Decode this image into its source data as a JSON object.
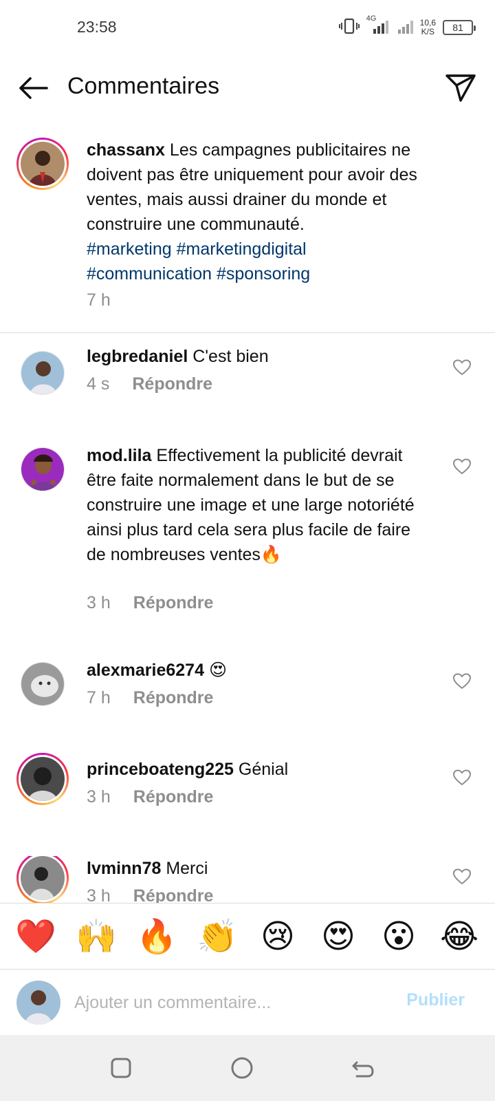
{
  "status": {
    "time": "23:58",
    "network": "4G",
    "speed_value": "10,6",
    "speed_unit": "K/S",
    "battery": "81"
  },
  "header": {
    "title": "Commentaires",
    "back_icon": "arrow-left-icon",
    "share_icon": "paper-plane-icon"
  },
  "caption": {
    "username": "chassanx",
    "text": "Les campagnes publicitaires ne doivent pas être uniquement pour avoir des ventes, mais aussi drainer du monde et construire une communauté.",
    "hashtags": [
      "#marketing",
      "#marketingdigital",
      "#communication",
      "#sponsoring"
    ],
    "time": "7 h"
  },
  "comments": [
    {
      "username": "legbredaniel",
      "text": "C'est bien",
      "time": "4 s",
      "reply": "Répondre"
    },
    {
      "username": "mod.lila",
      "text": "Effectivement la publicité devrait être faite normalement dans le but de se construire une image et une large notoriété ainsi plus tard cela sera plus facile de faire de nombreuses ventes🔥",
      "time": "3 h",
      "reply": "Répondre"
    },
    {
      "username": "alexmarie6274",
      "text": "😍",
      "time": "7 h",
      "reply": "Répondre"
    },
    {
      "username": "princeboateng225",
      "text": "Génial",
      "time": "3 h",
      "reply": "Répondre"
    },
    {
      "username": "lvminn78",
      "text": "Merci",
      "time": "3 h",
      "reply": "Répondre"
    }
  ],
  "emoji_bar": [
    "❤️",
    "🙌",
    "🔥",
    "👏",
    "😢",
    "😍",
    "😮",
    "😂"
  ],
  "composer": {
    "placeholder": "Ajouter un commentaire...",
    "publish": "Publier"
  },
  "colors": {
    "hashtag": "#00376b",
    "meta_gray": "#8e8e8e",
    "publish_disabled": "#b2dffc"
  }
}
